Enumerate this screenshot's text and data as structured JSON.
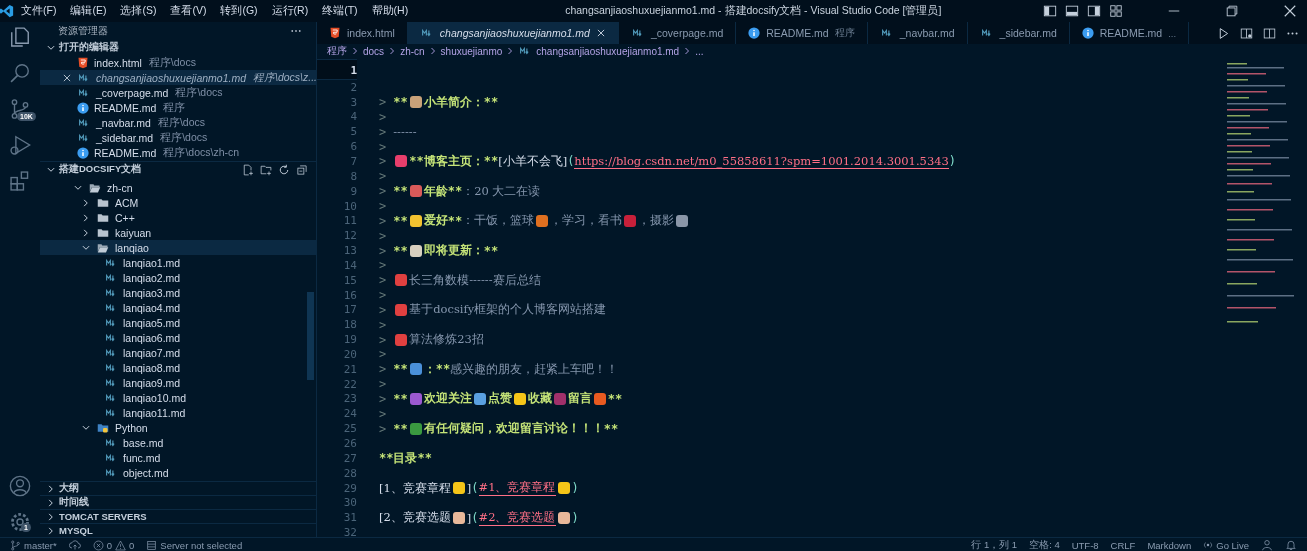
{
  "menu": [
    "文件(F)",
    "编辑(E)",
    "选择(S)",
    "查看(V)",
    "转到(G)",
    "运行(R)",
    "终端(T)",
    "帮助(H)"
  ],
  "window": {
    "title": "changsanjiaoshuxuejianmo1.md - 搭建docsify文档 - Visual Studio Code [管理员]"
  },
  "activity_bar": {
    "source_control_badge": "10K",
    "settings_badge": "1"
  },
  "sidebar": {
    "title": "资源管理器",
    "open_editors": {
      "title": "打开的编辑器",
      "expanded": true,
      "items": [
        {
          "name": "index.html",
          "path": "程序\\docs",
          "kind": "html",
          "selected": false
        },
        {
          "name": "changsanjiaoshuxuejianmo1.md",
          "path": "程序\\docs\\z...",
          "kind": "md",
          "selected": true
        },
        {
          "name": "_coverpage.md",
          "path": "程序\\docs",
          "kind": "md",
          "selected": false
        },
        {
          "name": "README.md",
          "path": "程序",
          "kind": "info",
          "selected": false
        },
        {
          "name": "_navbar.md",
          "path": "程序\\docs",
          "kind": "md",
          "selected": false
        },
        {
          "name": "_sidebar.md",
          "path": "程序\\docs",
          "kind": "md",
          "selected": false
        },
        {
          "name": "README.md",
          "path": "程序\\docs\\zh-cn",
          "kind": "info",
          "selected": false
        }
      ]
    },
    "explorer": {
      "title": "搭建DOCSIFY文档",
      "expanded": true,
      "tree": [
        {
          "name": "zh-cn",
          "kind": "folder",
          "expanded": true,
          "selected": false,
          "children": [
            {
              "name": "ACM",
              "kind": "folder",
              "expanded": false,
              "selected": false
            },
            {
              "name": "C++",
              "kind": "folder",
              "expanded": false,
              "selected": false
            },
            {
              "name": "kaiyuan",
              "kind": "folder",
              "expanded": false,
              "selected": false
            },
            {
              "name": "lanqiao",
              "kind": "folder",
              "expanded": true,
              "selected": true,
              "children": [
                {
                  "name": "lanqiao1.md",
                  "kind": "md",
                  "selected": false
                },
                {
                  "name": "lanqiao2.md",
                  "kind": "md",
                  "selected": false
                },
                {
                  "name": "lanqiao3.md",
                  "kind": "md",
                  "selected": false
                },
                {
                  "name": "lanqiao4.md",
                  "kind": "md",
                  "selected": false
                },
                {
                  "name": "lanqiao5.md",
                  "kind": "md",
                  "selected": false
                },
                {
                  "name": "lanqiao6.md",
                  "kind": "md",
                  "selected": false
                },
                {
                  "name": "lanqiao7.md",
                  "kind": "md",
                  "selected": false
                },
                {
                  "name": "lanqiao8.md",
                  "kind": "md",
                  "selected": false
                },
                {
                  "name": "lanqiao9.md",
                  "kind": "md",
                  "selected": false
                },
                {
                  "name": "lanqiao10.md",
                  "kind": "md",
                  "selected": false
                },
                {
                  "name": "lanqiao11.md",
                  "kind": "md",
                  "selected": false
                }
              ]
            },
            {
              "name": "Python",
              "kind": "python-folder",
              "expanded": true,
              "selected": false,
              "children": [
                {
                  "name": "base.md",
                  "kind": "md",
                  "selected": false
                },
                {
                  "name": "func.md",
                  "kind": "md",
                  "selected": false
                },
                {
                  "name": "object.md",
                  "kind": "md",
                  "selected": false
                }
              ]
            }
          ]
        }
      ]
    },
    "panels": [
      {
        "title": "大纲",
        "expanded": false
      },
      {
        "title": "时间线",
        "expanded": false
      },
      {
        "title": "TOMCAT SERVERS",
        "expanded": false
      },
      {
        "title": "MYSQL",
        "expanded": false
      }
    ]
  },
  "tabs": [
    {
      "label": "index.html",
      "kind": "html",
      "selected": false
    },
    {
      "label": "changsanjiaoshuxuejianmo1.md",
      "kind": "md",
      "selected": true
    },
    {
      "label": "_coverpage.md",
      "kind": "md",
      "selected": false
    },
    {
      "label": "README.md",
      "description": "程序",
      "kind": "info",
      "selected": false
    },
    {
      "label": "_navbar.md",
      "kind": "md",
      "selected": false
    },
    {
      "label": "_sidebar.md",
      "kind": "md",
      "selected": false
    },
    {
      "label": "README.md",
      "description": "...",
      "kind": "info",
      "selected": false
    }
  ],
  "breadcrumb": [
    "程序",
    "docs",
    "zh-cn",
    "shuxuejianmo",
    "changsanjiaoshuxuejianmo1.md",
    "..."
  ],
  "editor": {
    "lines": [
      {
        "n": "1",
        "active": true
      },
      {
        "n": "2",
        "active": false
      },
      {
        "n": "3",
        "active": false,
        "segments": [
          {
            "kind": "quote",
            "text": ">"
          },
          {
            "kind": "mark",
            "text": "**"
          },
          {
            "kind": "emoji",
            "color": "#c9a27a"
          },
          {
            "kind": "bold",
            "text": "小羊简介："
          },
          {
            "kind": "mark",
            "text": "**"
          }
        ]
      },
      {
        "n": "4",
        "active": false,
        "segments": [
          {
            "kind": "quote",
            "text": ">"
          }
        ]
      },
      {
        "n": "5",
        "active": false,
        "segments": [
          {
            "kind": "quote",
            "text": ">"
          },
          {
            "kind": "plain",
            "text": "------"
          }
        ]
      },
      {
        "n": "6",
        "active": false,
        "segments": [
          {
            "kind": "quote",
            "text": ">"
          }
        ]
      },
      {
        "n": "7",
        "active": false,
        "segments": [
          {
            "kind": "quote",
            "text": ">"
          },
          {
            "kind": "emoji",
            "color": "#e83e6c"
          },
          {
            "kind": "mark",
            "text": "**"
          },
          {
            "kind": "bold",
            "text": "博客主页："
          },
          {
            "kind": "mark",
            "text": "**"
          },
          {
            "kind": "link",
            "text": "[小羊不会飞]"
          },
          {
            "kind": "paren",
            "text": "("
          },
          {
            "kind": "url",
            "text": "https://blog.csdn.net/m0_55858611?spm=1001.2014.3001.5343"
          },
          {
            "kind": "paren",
            "text": ")"
          }
        ]
      },
      {
        "n": "8",
        "active": false,
        "segments": [
          {
            "kind": "quote",
            "text": ">"
          }
        ]
      },
      {
        "n": "9",
        "active": false,
        "segments": [
          {
            "kind": "quote",
            "text": ">"
          },
          {
            "kind": "mark",
            "text": "**"
          },
          {
            "kind": "emoji",
            "color": "#d95a5a"
          },
          {
            "kind": "bold",
            "text": "年龄"
          },
          {
            "kind": "mark",
            "text": "**"
          },
          {
            "kind": "plain",
            "text": "：20  大二在读"
          }
        ]
      },
      {
        "n": "10",
        "active": false,
        "segments": [
          {
            "kind": "quote",
            "text": ">"
          }
        ]
      },
      {
        "n": "11",
        "active": false,
        "segments": [
          {
            "kind": "quote",
            "text": ">"
          },
          {
            "kind": "mark",
            "text": "**"
          },
          {
            "kind": "emoji",
            "color": "#f2c230"
          },
          {
            "kind": "bold",
            "text": "爱好"
          },
          {
            "kind": "mark",
            "text": "**"
          },
          {
            "kind": "plain",
            "text": "：干饭，篮球"
          },
          {
            "kind": "emoji",
            "color": "#e07020"
          },
          {
            "kind": "plain",
            "text": "，学习，看书"
          },
          {
            "kind": "emoji",
            "color": "#c8203a"
          },
          {
            "kind": "plain",
            "text": "，摄影"
          },
          {
            "kind": "emoji",
            "color": "#8a96a8"
          }
        ]
      },
      {
        "n": "12",
        "active": false,
        "segments": [
          {
            "kind": "quote",
            "text": ">"
          }
        ]
      },
      {
        "n": "13",
        "active": false,
        "segments": [
          {
            "kind": "quote",
            "text": ">"
          },
          {
            "kind": "mark",
            "text": "**"
          },
          {
            "kind": "emoji",
            "color": "#d8d0c0"
          },
          {
            "kind": "bold",
            "text": "即将更新："
          },
          {
            "kind": "mark",
            "text": "**"
          }
        ]
      },
      {
        "n": "14",
        "active": false,
        "segments": [
          {
            "kind": "quote",
            "text": ">"
          }
        ]
      },
      {
        "n": "15",
        "active": false,
        "segments": [
          {
            "kind": "quote",
            "text": ">"
          },
          {
            "kind": "emoji",
            "color": "#e04040"
          },
          {
            "kind": "plain",
            "text": "长三角数模------赛后总结"
          }
        ]
      },
      {
        "n": "16",
        "active": false,
        "segments": [
          {
            "kind": "quote",
            "text": ">"
          }
        ]
      },
      {
        "n": "17",
        "active": false,
        "segments": [
          {
            "kind": "quote",
            "text": ">"
          },
          {
            "kind": "emoji",
            "color": "#e04040"
          },
          {
            "kind": "plain",
            "text": "基于docsify框架的个人博客网站搭建"
          }
        ]
      },
      {
        "n": "18",
        "active": false,
        "segments": [
          {
            "kind": "quote",
            "text": ">"
          }
        ]
      },
      {
        "n": "19",
        "active": false,
        "segments": [
          {
            "kind": "quote",
            "text": ">"
          },
          {
            "kind": "emoji",
            "color": "#e04040"
          },
          {
            "kind": "plain",
            "text": "算法修炼23招"
          }
        ]
      },
      {
        "n": "20",
        "active": false,
        "segments": [
          {
            "kind": "quote",
            "text": ">"
          }
        ]
      },
      {
        "n": "21",
        "active": false,
        "segments": [
          {
            "kind": "quote",
            "text": ">"
          },
          {
            "kind": "mark",
            "text": "**"
          },
          {
            "kind": "emoji",
            "color": "#4a90d9"
          },
          {
            "kind": "bold",
            "text": "："
          },
          {
            "kind": "mark",
            "text": "**"
          },
          {
            "kind": "plain",
            "text": "感兴趣的朋友，赶紧上车吧！！"
          }
        ]
      },
      {
        "n": "22",
        "active": false,
        "segments": [
          {
            "kind": "quote",
            "text": ">"
          }
        ]
      },
      {
        "n": "23",
        "active": false,
        "segments": [
          {
            "kind": "quote",
            "text": ">"
          },
          {
            "kind": "mark",
            "text": "**"
          },
          {
            "kind": "emoji",
            "color": "#9b59d0"
          },
          {
            "kind": "bold",
            "text": "欢迎关注"
          },
          {
            "kind": "emoji",
            "color": "#5aa0e0"
          },
          {
            "kind": "bold",
            "text": "点赞"
          },
          {
            "kind": "emoji",
            "color": "#f5c518"
          },
          {
            "kind": "bold",
            "text": "收藏"
          },
          {
            "kind": "emoji",
            "color": "#a0306a"
          },
          {
            "kind": "bold",
            "text": "留言"
          },
          {
            "kind": "emoji",
            "color": "#e85a20"
          },
          {
            "kind": "mark",
            "text": "**"
          }
        ]
      },
      {
        "n": "24",
        "active": false,
        "segments": [
          {
            "kind": "quote",
            "text": ">"
          }
        ]
      },
      {
        "n": "25",
        "active": false,
        "segments": [
          {
            "kind": "quote",
            "text": ">"
          },
          {
            "kind": "mark",
            "text": "**"
          },
          {
            "kind": "emoji",
            "color": "#3a9a40"
          },
          {
            "kind": "bold",
            "text": "有任何疑问，欢迎留言讨论！！！"
          },
          {
            "kind": "mark",
            "text": "**"
          }
        ]
      },
      {
        "n": "26",
        "active": false
      },
      {
        "n": "27",
        "active": false,
        "segments": [
          {
            "kind": "mark",
            "text": "**"
          },
          {
            "kind": "bold",
            "text": "目录"
          },
          {
            "kind": "mark",
            "text": "**"
          }
        ]
      },
      {
        "n": "28",
        "active": false
      },
      {
        "n": "29",
        "active": false,
        "segments": [
          {
            "kind": "link",
            "text": "[1、竞赛章程"
          },
          {
            "kind": "emoji",
            "color": "#f5c518"
          },
          {
            "kind": "link",
            "text": "]"
          },
          {
            "kind": "paren",
            "text": "("
          },
          {
            "kind": "url",
            "text": "#1、竞赛章程"
          },
          {
            "kind": "emoji",
            "color": "#f5c518"
          },
          {
            "kind": "paren",
            "text": ")"
          }
        ]
      },
      {
        "n": "30",
        "active": false
      },
      {
        "n": "31",
        "active": false,
        "segments": [
          {
            "kind": "link",
            "text": "[2、竞赛选题"
          },
          {
            "kind": "emoji",
            "color": "#e8b89a"
          },
          {
            "kind": "link",
            "text": "]"
          },
          {
            "kind": "paren",
            "text": "("
          },
          {
            "kind": "url",
            "text": "#2、竞赛选题"
          },
          {
            "kind": "emoji",
            "color": "#e8b89a"
          },
          {
            "kind": "paren",
            "text": ")"
          }
        ]
      },
      {
        "n": "32",
        "active": false
      }
    ]
  },
  "status_bar": {
    "branch": "master*",
    "errors": "0",
    "warnings": "0",
    "server": "Server not selected",
    "position": "行 1，列 1",
    "indent": "空格: 4",
    "encoding": "UTF-8",
    "eol": "CRLF",
    "language": "Markdown",
    "go_live": "Go Live"
  }
}
